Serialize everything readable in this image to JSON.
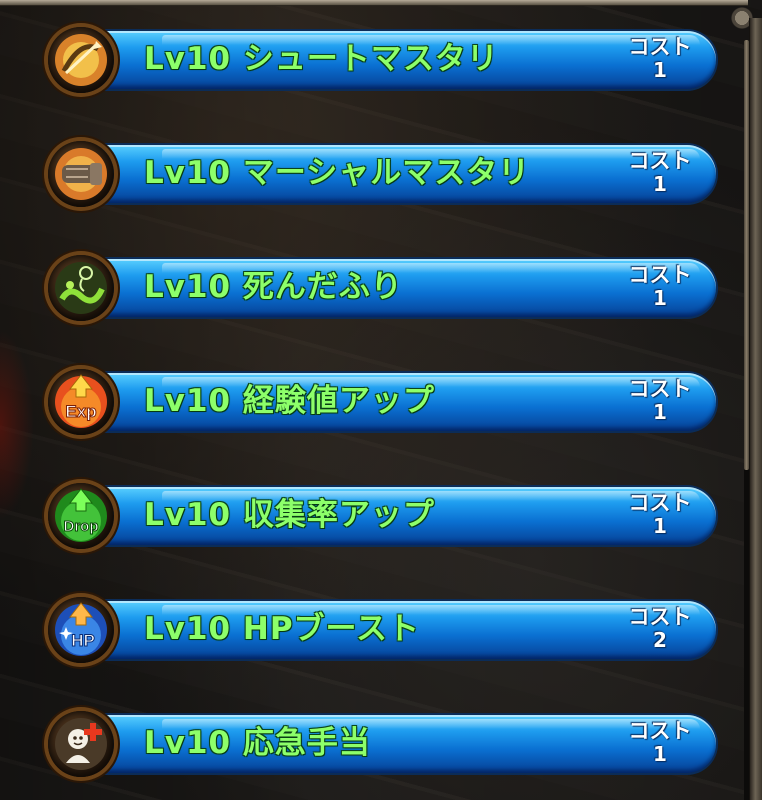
{
  "skills": [
    {
      "label": "Lv10 シュートマスタリ",
      "cost_label": "コスト",
      "cost": "1",
      "icon": "shoot-mastery-icon"
    },
    {
      "label": "Lv10 マーシャルマスタリ",
      "cost_label": "コスト",
      "cost": "1",
      "icon": "martial-mastery-icon"
    },
    {
      "label": "Lv10 死んだふり",
      "cost_label": "コスト",
      "cost": "1",
      "icon": "play-dead-icon"
    },
    {
      "label": "Lv10 経験値アップ",
      "cost_label": "コスト",
      "cost": "1",
      "icon": "exp-up-icon",
      "icon_text": "Exp"
    },
    {
      "label": "Lv10 収集率アップ",
      "cost_label": "コスト",
      "cost": "1",
      "icon": "drop-rate-up-icon",
      "icon_text": "Drop"
    },
    {
      "label": "Lv10 HPブースト",
      "cost_label": "コスト",
      "cost": "2",
      "icon": "hp-boost-icon",
      "icon_text": "HP"
    },
    {
      "label": "Lv10 応急手当",
      "cost_label": "コスト",
      "cost": "1",
      "icon": "first-aid-icon"
    }
  ],
  "colors": {
    "label": "#8dff6a",
    "bar_top": "#5ad0ff",
    "bar_bottom": "#063f93",
    "icon_ring": "#6a4218"
  }
}
